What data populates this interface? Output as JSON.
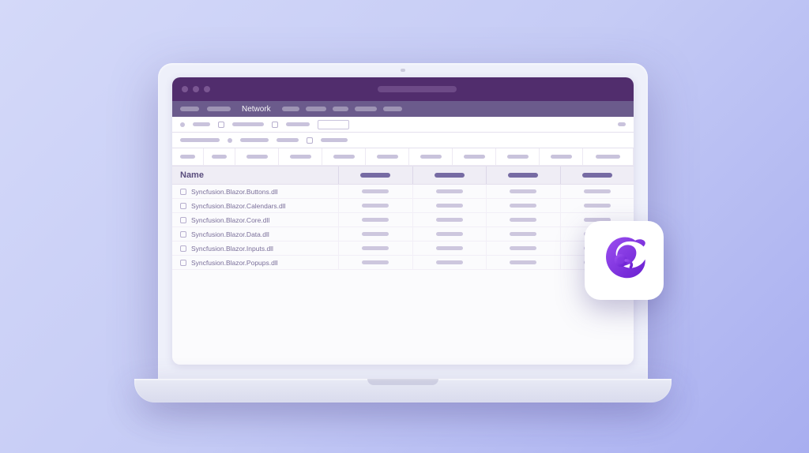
{
  "devtools": {
    "active_tab": "Network",
    "table": {
      "name_header": "Name",
      "rows": [
        {
          "name": "Syncfusion.Blazor.Buttons.dll"
        },
        {
          "name": "Syncfusion.Blazor.Calendars.dll"
        },
        {
          "name": "Syncfusion.Blazor.Core.dll"
        },
        {
          "name": "Syncfusion.Blazor.Data.dll"
        },
        {
          "name": "Syncfusion.Blazor.Inputs.dll"
        },
        {
          "name": "Syncfusion.Blazor.Popups.dll"
        }
      ]
    }
  },
  "logo": {
    "name": "blazor-logo",
    "accent": "#7a2fe0"
  }
}
